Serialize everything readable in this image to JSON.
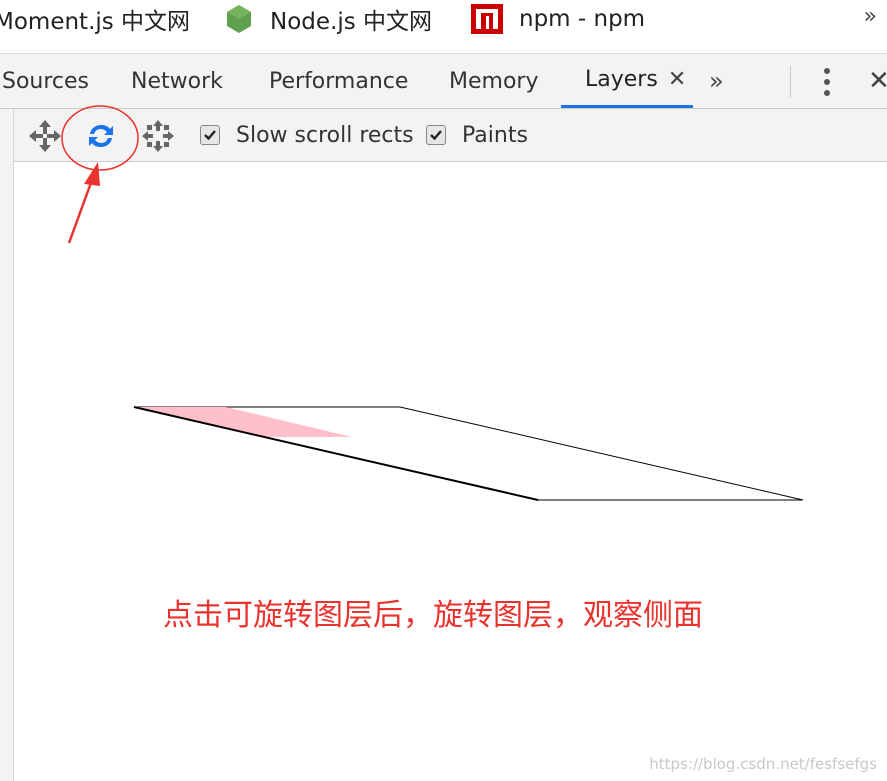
{
  "bookmarks": [
    {
      "label": "Moment.js 中文网"
    },
    {
      "label": "Node.js 中文网",
      "icon": "nodejs-hexagon-icon",
      "icon_color": "#5fa04e"
    },
    {
      "label": "npm - npm",
      "icon": "npm-logo-icon",
      "icon_color": "#cb0000"
    }
  ],
  "bookmarks_more": "»",
  "devtools": {
    "tabs": [
      {
        "label": "Sources"
      },
      {
        "label": "Network"
      },
      {
        "label": "Performance"
      },
      {
        "label": "Memory"
      },
      {
        "label": "Layers",
        "active": true
      }
    ],
    "active_tab_close": "✕",
    "overflow": "»",
    "close": "✕",
    "accent_color": "#1a73e8"
  },
  "layers_toolbar": {
    "tools": [
      {
        "name": "pan-mode",
        "icon": "move-arrows-icon"
      },
      {
        "name": "rotate-mode",
        "icon": "rotate-arrows-icon",
        "active": true,
        "active_color": "#1a73e8"
      },
      {
        "name": "reset-transform",
        "icon": "reset-arrows-icon"
      }
    ],
    "checkboxes": [
      {
        "label": "Slow scroll rects",
        "checked": true
      },
      {
        "label": "Paints",
        "checked": true
      }
    ]
  },
  "annotation": {
    "text": "点击可旋转图层后，旋转图层，观察侧面",
    "color": "#e8332e"
  },
  "layer_highlight_color": "#ffc0cb",
  "watermark": "https://blog.csdn.net/fesfsefgs"
}
